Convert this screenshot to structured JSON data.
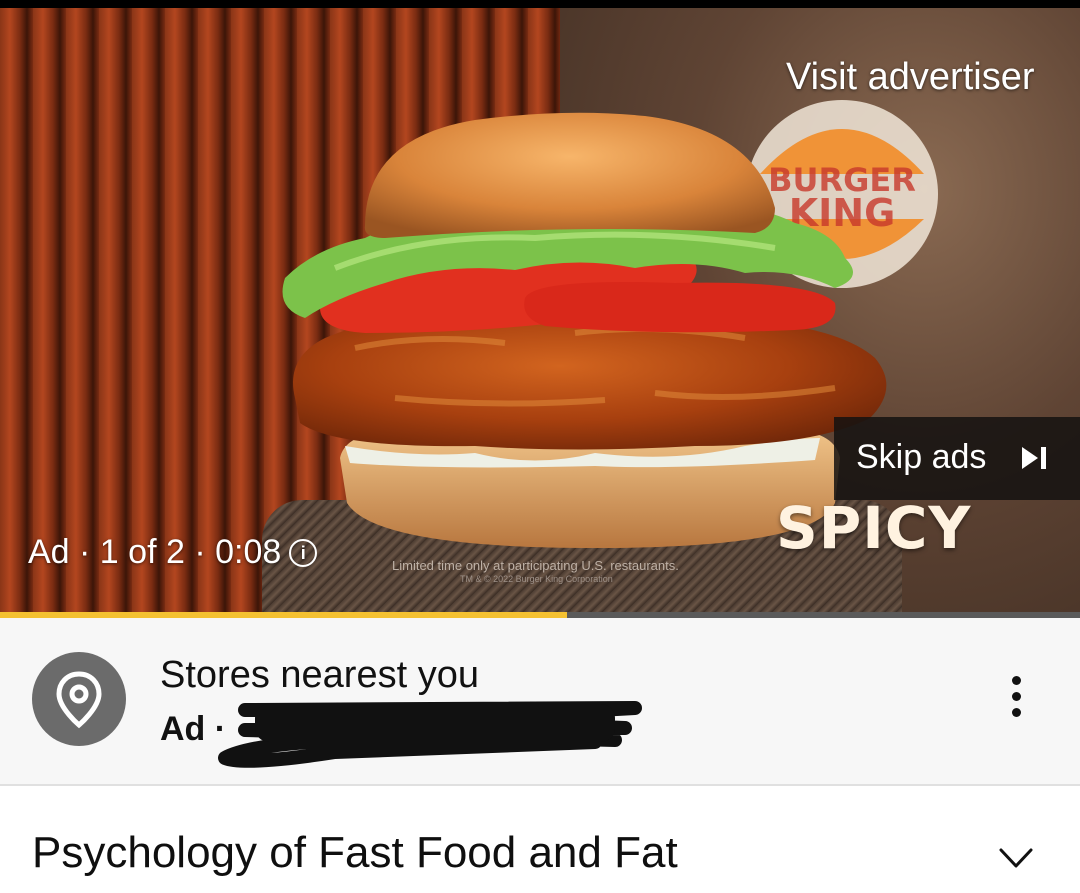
{
  "player": {
    "visit_advertiser": "Visit advertiser",
    "ad_counter": "Ad · 1 of 2 · 0:08",
    "skip_label": "Skip ads",
    "overlay_word": "SPICY",
    "disclaimer": "Limited time only at participating U.S. restaurants.",
    "disclaimer_small": "TM & © 2022 Burger King Corporation",
    "logo_text_top": "BURGER",
    "logo_text_bottom": "KING",
    "progress_fraction": 0.525,
    "progress_color": "#f4c131"
  },
  "ad_card": {
    "icon": "location-pin-icon",
    "title": "Stores nearest you",
    "label": "Ad ·"
  },
  "video": {
    "title": "Psychology of Fast Food and Fat"
  },
  "icons": {
    "info": "info-icon",
    "skip": "skip-next-icon",
    "more": "more-vert-icon",
    "expand": "chevron-down-icon"
  }
}
